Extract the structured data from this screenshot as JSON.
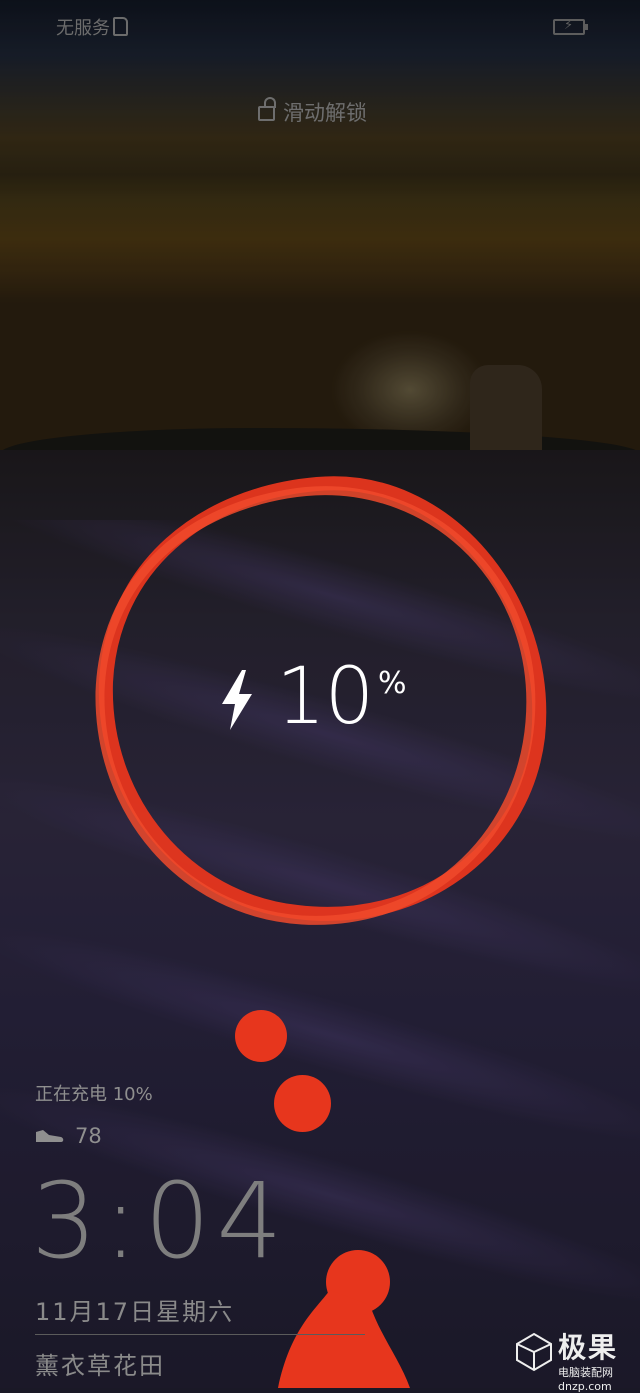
{
  "status_bar": {
    "carrier": "无服务"
  },
  "unlock_hint": "滑动解锁",
  "charge_indicator": {
    "value": "10",
    "unit": "%"
  },
  "lock_info": {
    "charging_status": "正在充电 10%",
    "steps": "78",
    "time": "3:04",
    "date": "11月17日星期六",
    "wallpaper_caption": "薰衣草花田"
  },
  "watermark": {
    "title": "极果",
    "subtitle": "电脑装配网  dnzp.com"
  },
  "colors": {
    "accent": "#e7361d",
    "text_dim": "#8f8f8f",
    "wallpaper_field": "#2a2540"
  },
  "icons": [
    "sim-card-icon",
    "battery-charging-icon",
    "lock-icon",
    "lightning-bolt-icon",
    "shoe-icon"
  ]
}
